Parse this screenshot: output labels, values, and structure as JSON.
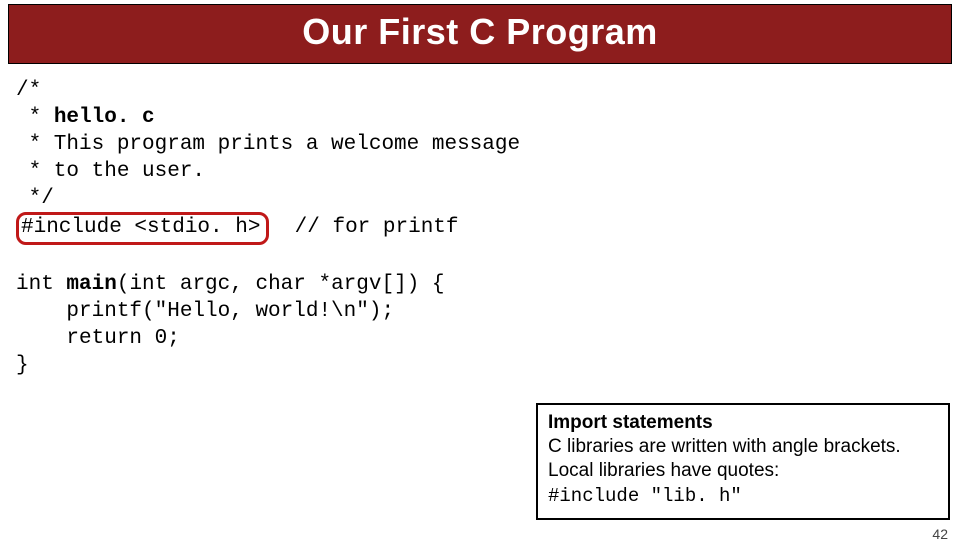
{
  "title": "Our First C Program",
  "code": {
    "l1": "/*",
    "l2_pre": " * ",
    "l2_bold": "hello. c",
    "l3": " * This program prints a welcome message",
    "l4": " * to the user.",
    "l5": " */",
    "l6_include": "#include <stdio. h>",
    "l6_gap": "  ",
    "l6_comment": "// for printf",
    "blank": " ",
    "l7_pre": "int ",
    "l7_bold": "main",
    "l7_rest": "(int argc, char *argv[]) {",
    "l8": "    printf(\"Hello, world!\\n\");",
    "l9": "    return 0;",
    "l10": "}"
  },
  "callout": {
    "line1": "Import statements",
    "line2": "C libraries are written with angle brackets.",
    "line3": "Local libraries have quotes:",
    "line4": "#include \"lib. h\""
  },
  "page_number": "42"
}
